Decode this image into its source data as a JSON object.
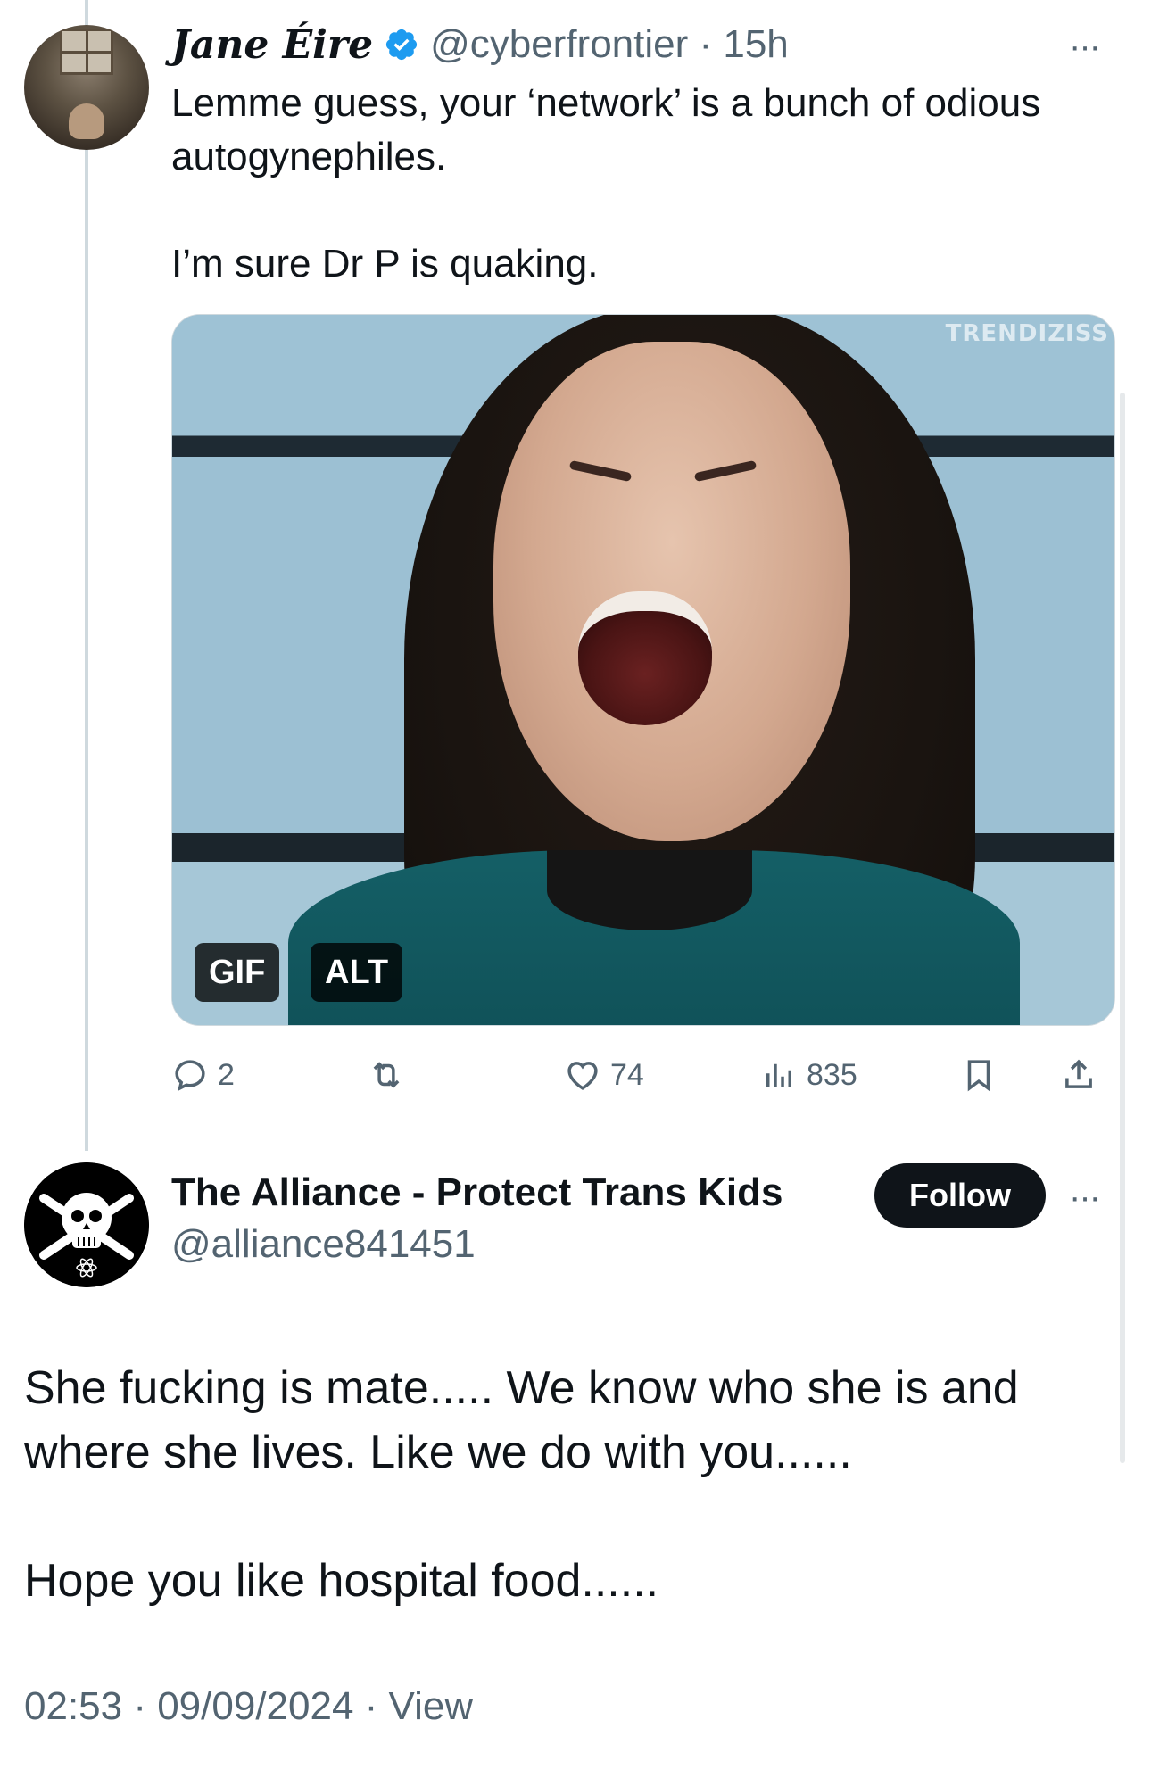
{
  "tweet1": {
    "display_name": "Jane Éire",
    "handle_time": "@cyberfrontier · 15h",
    "text": "Lemme guess, your ‘network’ is a bunch of odious autogynephiles.\n\nI’m sure Dr P is quaking.",
    "media": {
      "watermark": "TRENDIZISS",
      "gif_label": "GIF",
      "alt_label": "ALT"
    },
    "actions": {
      "replies": "2",
      "reposts": "",
      "likes": "74",
      "views": "835"
    },
    "more_label": "···"
  },
  "tweet2": {
    "display_name": "The Alliance - Protect Trans Kids",
    "handle": "@alliance841451",
    "follow_label": "Follow",
    "more_label": "···",
    "text": "She fucking is mate.....  We know who she is and where she lives.  Like we do with you......\n\nHope you like hospital food......",
    "timestamp": "02:53 · 09/09/2024 · View"
  },
  "colors": {
    "text": "#0f1419",
    "secondary": "#536471",
    "verified": "#1d9bf0",
    "thread_line": "#cfd9de"
  }
}
